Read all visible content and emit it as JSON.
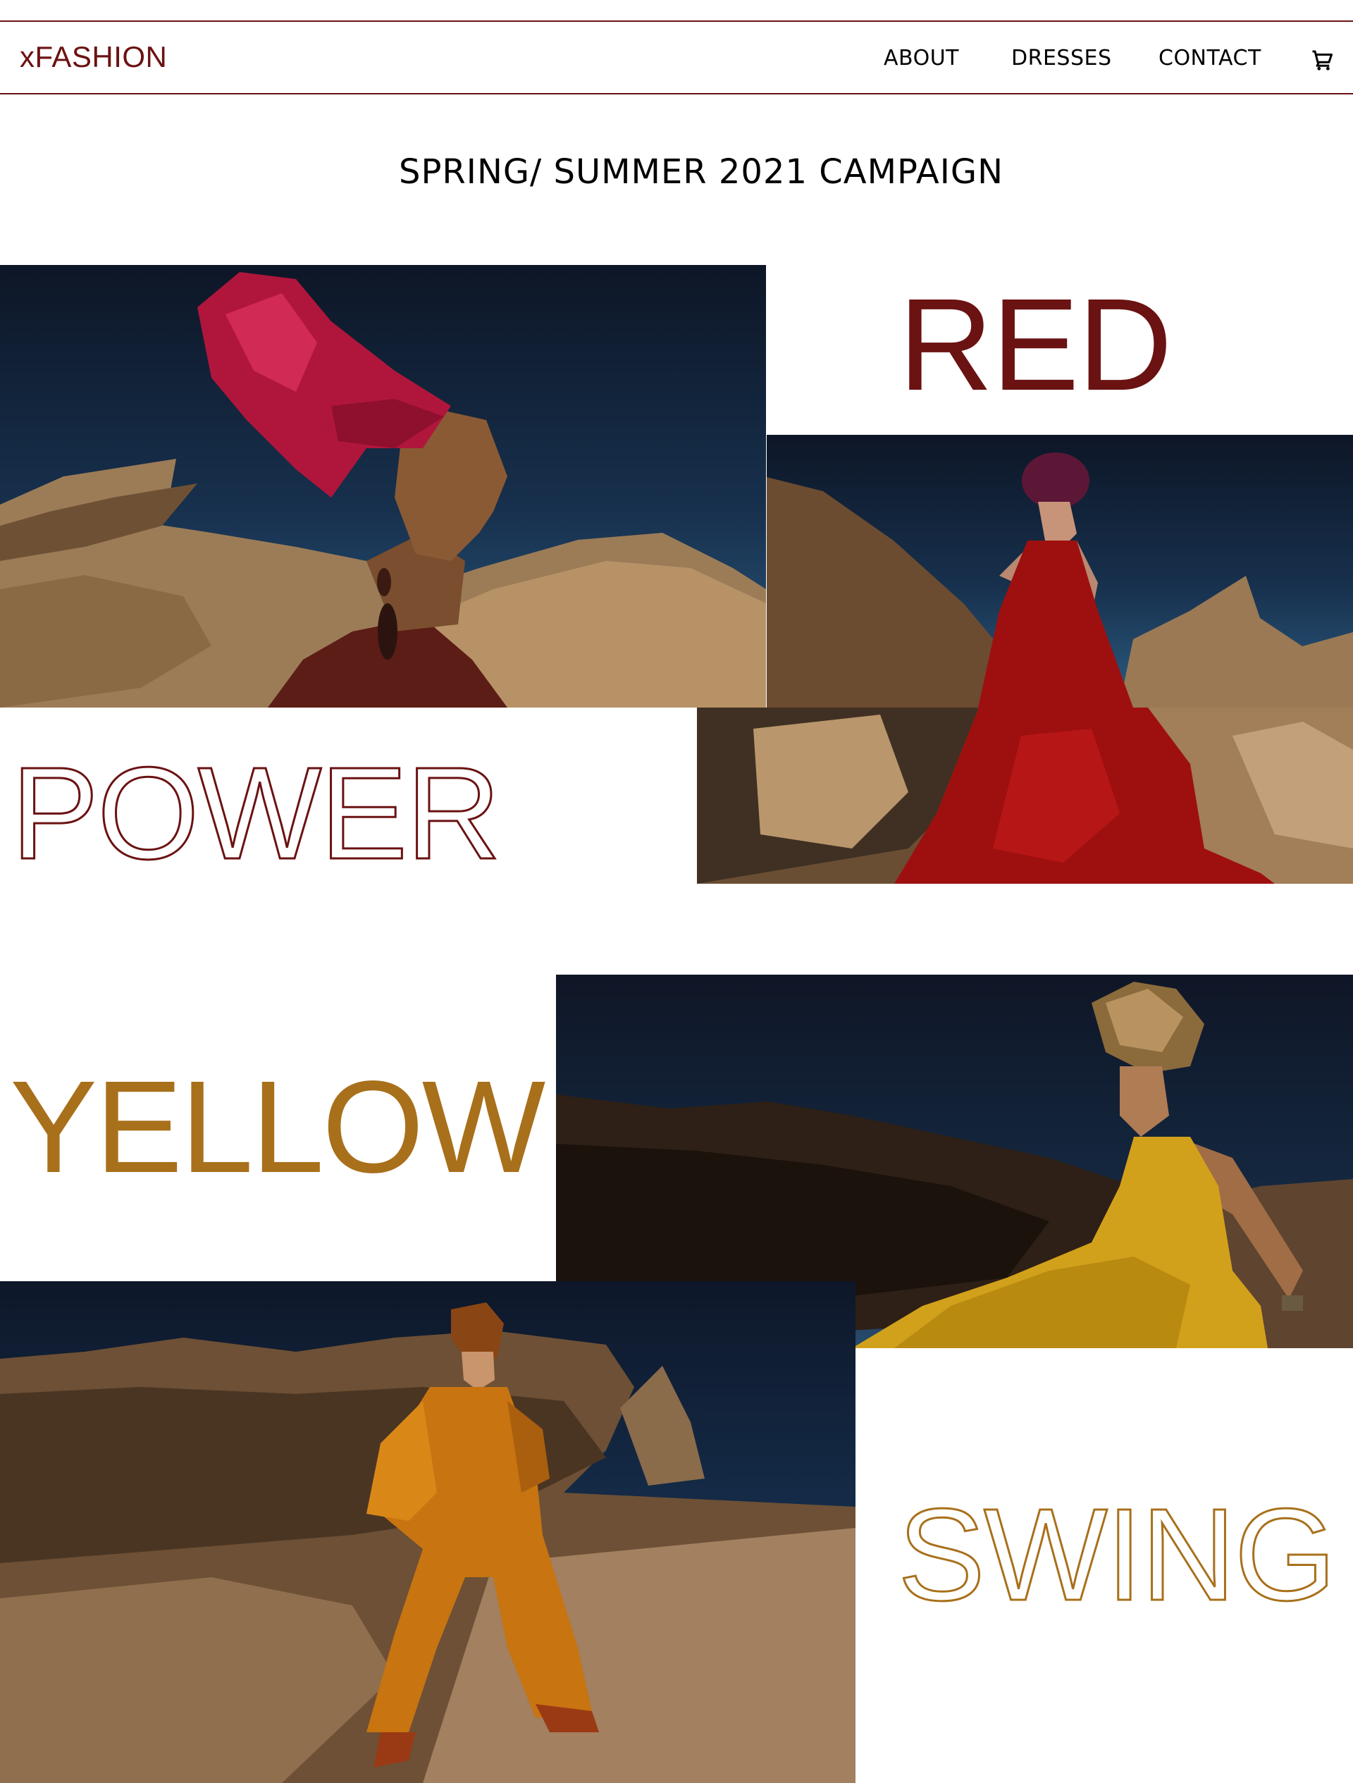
{
  "header": {
    "brand": "xFASHION",
    "nav": {
      "about": "ABOUT",
      "dresses": "DRESSES",
      "contact": "CONTACT"
    },
    "cart_icon": "shopping-cart-icon"
  },
  "campaign": {
    "title": "SPRING/ SUMMER 2021 CAMPAIGN"
  },
  "words": {
    "red": "RED",
    "power": "POWER",
    "yellow": "YELLOW",
    "swing": "SWING"
  },
  "colors": {
    "accent_red": "#6b1212",
    "accent_yellow": "#a8701b"
  }
}
